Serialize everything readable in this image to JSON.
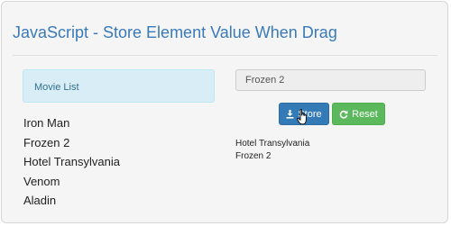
{
  "page": {
    "title": "JavaScript - Store Element Value When Drag"
  },
  "movie_list": {
    "header": "Movie List",
    "items": [
      {
        "label": "Iron Man"
      },
      {
        "label": "Frozen 2"
      },
      {
        "label": "Hotel Transylvania"
      },
      {
        "label": "Venom"
      },
      {
        "label": "Aladin"
      }
    ]
  },
  "input": {
    "value": "Frozen 2"
  },
  "buttons": {
    "store_label": "Store",
    "store_icon": "download-icon",
    "reset_label": "Reset",
    "reset_icon": "refresh-icon"
  },
  "stored": {
    "items": [
      {
        "label": "Hotel Transylvania"
      },
      {
        "label": "Frozen 2"
      }
    ]
  },
  "colors": {
    "title": "#3a7ab8",
    "info_bg": "#d9edf7",
    "store_button": "#337ab7",
    "reset_button": "#5cb85c"
  }
}
